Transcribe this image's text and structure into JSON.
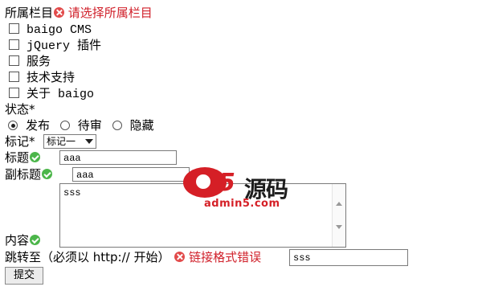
{
  "category": {
    "label": "所属栏目",
    "error": "请选择所属栏目",
    "items": [
      "baigo CMS",
      "jQuery 插件",
      "服务",
      "技术支持",
      "关于 baigo"
    ]
  },
  "status": {
    "label": "状态*",
    "options": [
      "发布",
      "待审",
      "隐藏"
    ],
    "selected": "发布"
  },
  "mark": {
    "label": "标记*",
    "selected": "标记一"
  },
  "title": {
    "label": "标题",
    "value": "aaa"
  },
  "subtitle": {
    "label": "副标题",
    "value": "aaa"
  },
  "content": {
    "label": "内容",
    "value": "sss"
  },
  "redirect": {
    "label": "跳转至（必须以 http:// 开始）",
    "error": "链接格式错误",
    "value": "sss"
  },
  "submit_label": "提交",
  "watermark": {
    "logo_char": "5",
    "brand": "源码",
    "url": "admin5.com"
  },
  "colors": {
    "error_red": "#d0202a",
    "ok_green": "#4cb64a"
  }
}
